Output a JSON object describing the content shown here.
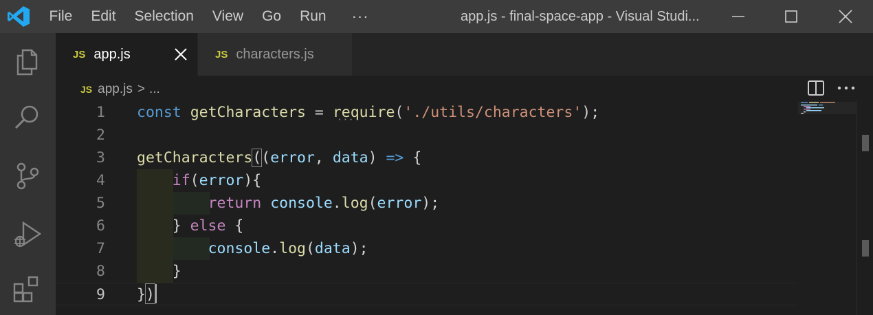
{
  "titlebar": {
    "menu": [
      "File",
      "Edit",
      "Selection",
      "View",
      "Go",
      "Run"
    ],
    "more": "···",
    "title": "app.js - final-space-app - Visual Studi..."
  },
  "activity_bar": [
    "explorer-icon",
    "search-icon",
    "source-control-icon",
    "run-debug-icon",
    "extensions-icon"
  ],
  "tabs": [
    {
      "badge": "JS",
      "label": "app.js",
      "active": true
    },
    {
      "badge": "JS",
      "label": "characters.js",
      "active": false
    }
  ],
  "breadcrumb": {
    "badge": "JS",
    "file": "app.js",
    "sep": ">",
    "rest": "..."
  },
  "editor": {
    "line_numbers": [
      "1",
      "2",
      "3",
      "4",
      "5",
      "6",
      "7",
      "8",
      "9"
    ],
    "active_line": "9",
    "colors": {
      "keyword": "#569cd6",
      "control": "#c586c0",
      "function": "#dcdcaa",
      "variable": "#9cdcfe",
      "string": "#ce9178",
      "text": "#d4d4d4"
    },
    "lines": [
      [
        {
          "t": "const",
          "c": "kw"
        },
        {
          "t": " "
        },
        {
          "t": "getCharacters",
          "c": "fn"
        },
        {
          "t": " = "
        },
        {
          "t": "require",
          "c": "fn"
        },
        {
          "t": "("
        },
        {
          "t": "'./utils/characters'",
          "c": "str"
        },
        {
          "t": ");"
        }
      ],
      [],
      [
        {
          "t": "getCharacters",
          "c": "fn"
        },
        {
          "t": "(",
          "c": "bm"
        },
        {
          "t": "("
        },
        {
          "t": "error",
          "c": "var"
        },
        {
          "t": ", "
        },
        {
          "t": "data",
          "c": "var"
        },
        {
          "t": ") "
        },
        {
          "t": "=>",
          "c": "kw"
        },
        {
          "t": " {"
        }
      ],
      [
        {
          "t": "    "
        },
        {
          "t": "if",
          "c": "ctrl"
        },
        {
          "t": "("
        },
        {
          "t": "error",
          "c": "var"
        },
        {
          "t": "){"
        }
      ],
      [
        {
          "t": "        "
        },
        {
          "t": "return",
          "c": "ctrl"
        },
        {
          "t": " "
        },
        {
          "t": "console",
          "c": "var"
        },
        {
          "t": "."
        },
        {
          "t": "log",
          "c": "fn"
        },
        {
          "t": "("
        },
        {
          "t": "error",
          "c": "var"
        },
        {
          "t": ");"
        }
      ],
      [
        {
          "t": "    "
        },
        {
          "t": "} "
        },
        {
          "t": "else",
          "c": "ctrl"
        },
        {
          "t": " {"
        }
      ],
      [
        {
          "t": "        "
        },
        {
          "t": "console",
          "c": "var"
        },
        {
          "t": "."
        },
        {
          "t": "log",
          "c": "fn"
        },
        {
          "t": "("
        },
        {
          "t": "data",
          "c": "var"
        },
        {
          "t": ");"
        }
      ],
      [
        {
          "t": "    }"
        }
      ],
      [
        {
          "t": "})",
          "c": "bm2"
        }
      ]
    ]
  }
}
